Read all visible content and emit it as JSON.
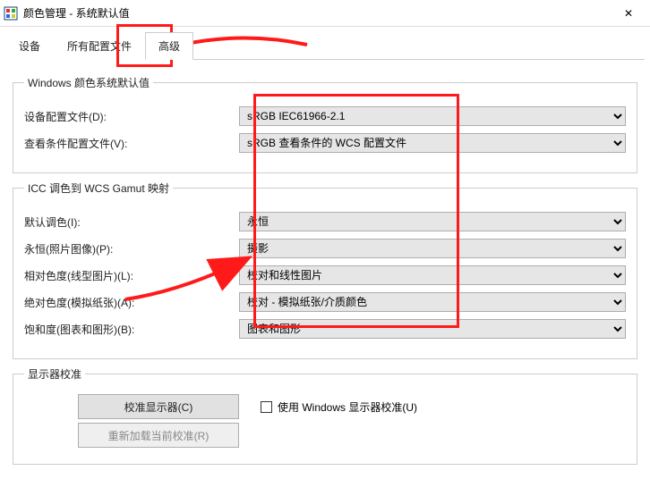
{
  "titlebar": {
    "title": "颜色管理 - 系统默认值",
    "close_symbol": "✕"
  },
  "tabs": {
    "device": "设备",
    "all_profiles": "所有配置文件",
    "advanced": "高级"
  },
  "group1": {
    "legend": "Windows 颜色系统默认值",
    "device_profile_label": "设备配置文件(D):",
    "device_profile_value": "sRGB IEC61966-2.1",
    "viewing_profile_label": "查看条件配置文件(V):",
    "viewing_profile_value": "sRGB 查看条件的 WCS 配置文件"
  },
  "group2": {
    "legend": "ICC 调色到 WCS Gamut 映射",
    "default_label": "默认调色(I):",
    "default_value": "永恒",
    "perm_label": "永恒(照片图像)(P):",
    "perm_value": "摄影",
    "rel_label": "相对色度(线型图片)(L):",
    "rel_value": "校对和线性图片",
    "abs_label": "绝对色度(模拟纸张)(A):",
    "abs_value": "校对 - 模拟纸张/介质颜色",
    "sat_label": "饱和度(图表和图形)(B):",
    "sat_value": "图表和图形"
  },
  "group3": {
    "legend": "显示器校准",
    "calibrate_btn": "校准显示器(C)",
    "use_windows_cal": "使用 Windows 显示器校准(U)",
    "reload_btn": "重新加载当前校准(R)"
  }
}
